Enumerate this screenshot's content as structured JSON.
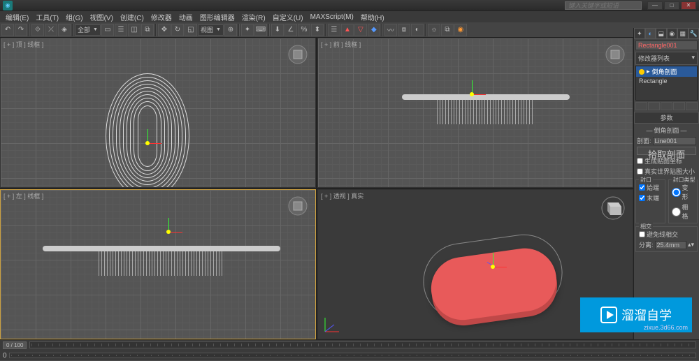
{
  "app": {
    "search_placeholder": "键入关键字或短语"
  },
  "menu": {
    "items": [
      "编辑(E)",
      "工具(T)",
      "组(G)",
      "视图(V)",
      "创建(C)",
      "修改器",
      "动画",
      "图形编辑器",
      "渲染(R)",
      "自定义(U)",
      "MAXScript(M)",
      "帮助(H)"
    ]
  },
  "toolbar": {
    "group_label": "全部",
    "view_label": "视图"
  },
  "viewports": {
    "top": "[ + ] 顶 ] 线框 ]",
    "front": "[ + ] 前 ] 线框 ]",
    "left": "[ + ] 左 ] 线框 ]",
    "persp": "[ + ] 透视 ] 真实"
  },
  "panel": {
    "object_name": "Rectangle001",
    "modifier_header": "修改器列表",
    "stack": {
      "item_selected": "倒角剖面",
      "item_base": "Rectangle"
    },
    "params_title": "参数",
    "bevel_profile_label": "倒角剖面",
    "section_label": "剖面:",
    "section_value": "Line001",
    "pick_btn": "拾取剖面",
    "gen_coords": "生成贴图坐标",
    "real_world": "真实世界贴图大小",
    "cap_group": "封口",
    "cap_type_group": "封口类型",
    "cap_start": "始端",
    "cap_end": "末端",
    "cap_morph": "变形",
    "cap_grid": "栅格",
    "intersect_group": "相交",
    "avoid_line": "避免线相交",
    "separation_label": "分离:",
    "separation_value": "25.4mm"
  },
  "timeline": {
    "frame": "0 / 100",
    "start": "0"
  },
  "watermark": {
    "text": "溜溜自学",
    "url": "zixue.3d66.com"
  }
}
